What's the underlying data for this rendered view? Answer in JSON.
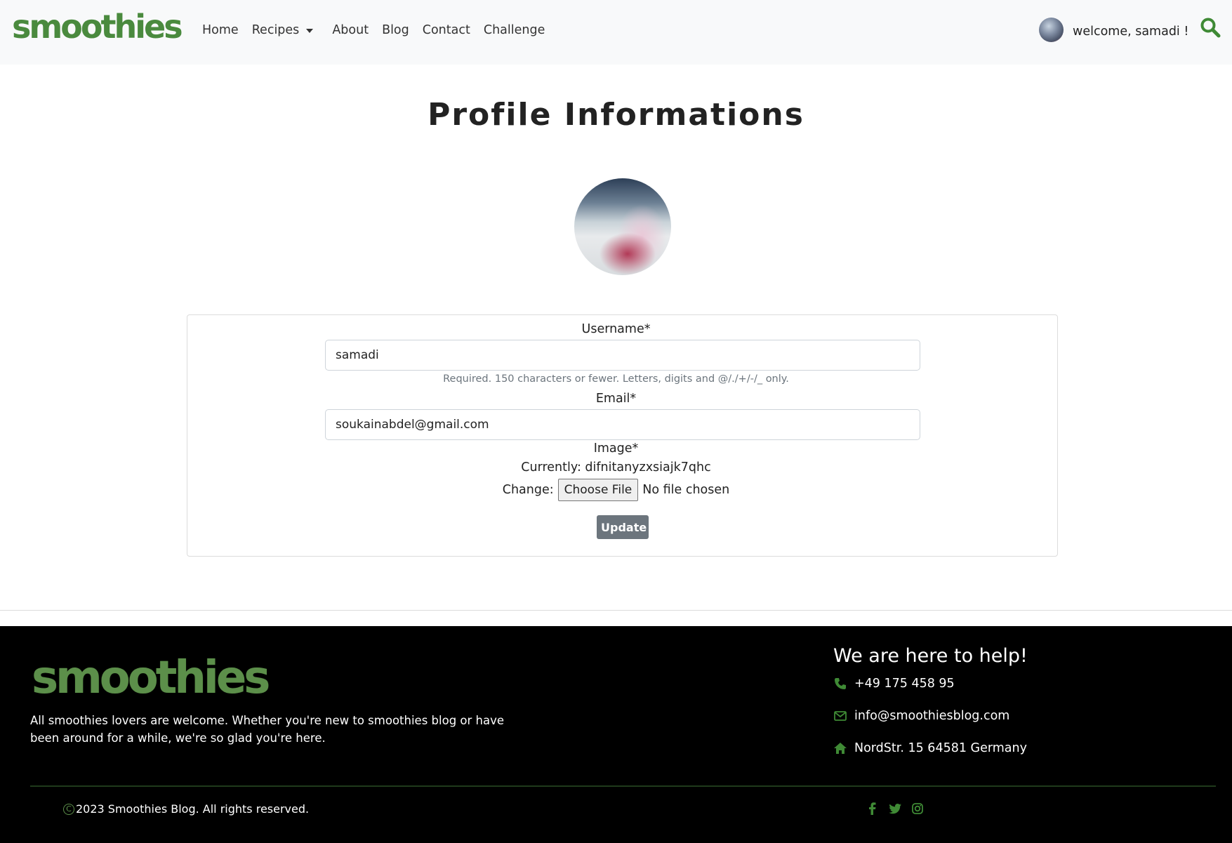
{
  "brand": {
    "logo_text": "smoothies"
  },
  "nav": {
    "items": [
      {
        "label": "Home"
      },
      {
        "label": "Recipes",
        "dropdown": true
      },
      {
        "label": "About"
      },
      {
        "label": "Blog"
      },
      {
        "label": "Contact"
      },
      {
        "label": "Challenge"
      }
    ],
    "welcome": "welcome, samadi !",
    "search_icon": "search-icon"
  },
  "page": {
    "title": "Profile Informations"
  },
  "form": {
    "username_label": "Username*",
    "username_value": "samadi",
    "username_help": "Required. 150 characters or fewer. Letters, digits and @/./+/-/_ only.",
    "email_label": "Email*",
    "email_value": "soukainabdel@gmail.com",
    "image_label": "Image*",
    "currently_text": "Currently: difnitanyzxsiajk7qhc",
    "change_label": "Change:",
    "choose_file": "Choose File",
    "no_file": "No file chosen",
    "update_button": "Update"
  },
  "footer": {
    "logo_text": "smoothies",
    "description": "All smoothies lovers are welcome. Whether you're new to smoothies blog or have been around for a while, we're so glad you're here.",
    "help_title": "We are here to help!",
    "phone": "+49 175 458 95",
    "email": "info@smoothiesblog.com",
    "address": "NordStr. 15 64581 Germany",
    "copyright": "2023 Smoothies Blog. All rights reserved.",
    "social_icons": [
      "facebook-icon",
      "twitter-icon",
      "instagram-icon"
    ]
  },
  "colors": {
    "brand_green": "#4a8a3e",
    "footer_bg": "#000000",
    "button_gray": "#6c757d"
  }
}
